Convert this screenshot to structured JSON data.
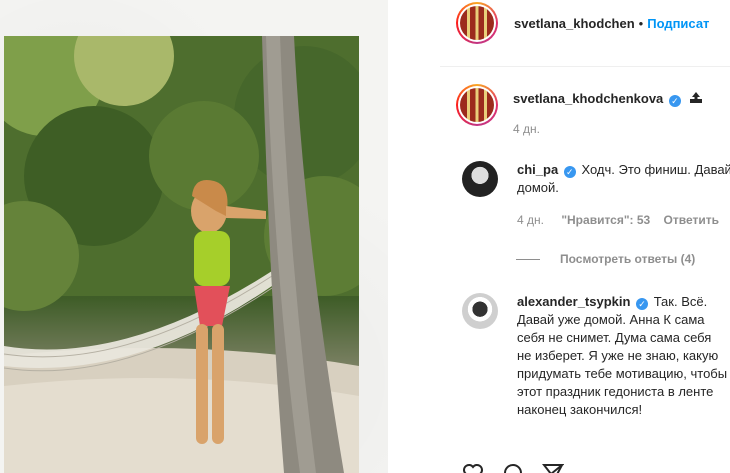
{
  "post_header": {
    "username": "svetlana_khodchen",
    "separator": "•",
    "follow_label": "Подписат"
  },
  "caption": {
    "username": "svetlana_khodchenkova",
    "time": "4 дн."
  },
  "comments": [
    {
      "username": "chi_pa",
      "text": "Ходч. Это финиш. Давай домой.",
      "time": "4 дн.",
      "likes": "\"Нравится\": 53",
      "reply_label": "Ответить"
    },
    {
      "username": "alexander_tsypkin",
      "text": "Так. Всё. Давай уже домой. Анна К сама себя не снимет. Дума сама себя не изберет. Я уже не знаю, какую придумать тебе мотивацию, чтобы этот праздник гедониста в ленте наконец закончился!"
    }
  ],
  "view_replies": "Посмотреть ответы (4)",
  "colors": {
    "link_blue": "#0095f6",
    "verified_blue": "#3897f0",
    "text": "#262626",
    "muted": "#8e8e8e"
  },
  "icons": [
    "verified-icon",
    "upload-icon",
    "heart-icon",
    "comment-icon",
    "share-icon"
  ]
}
